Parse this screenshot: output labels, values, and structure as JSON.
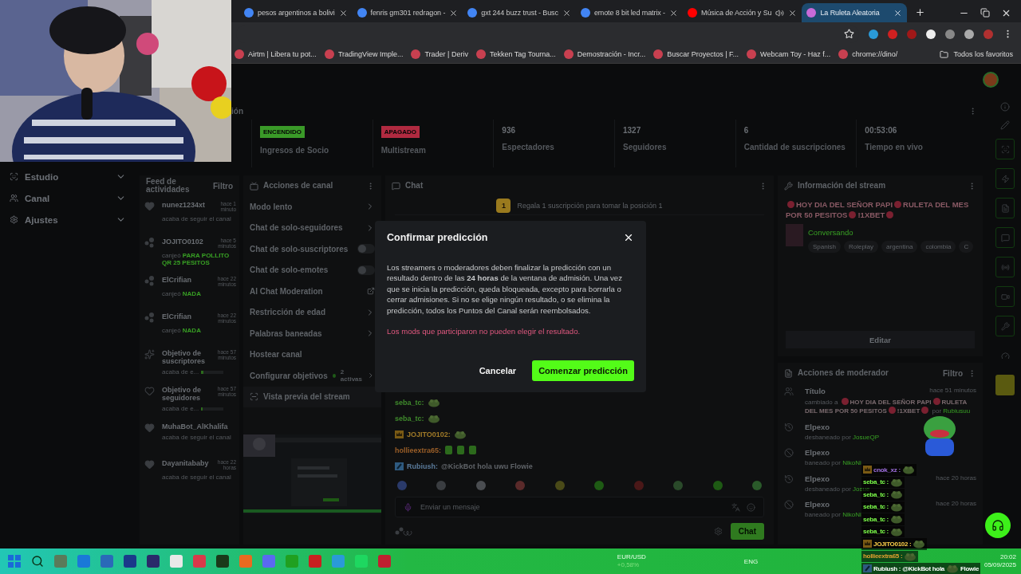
{
  "browser": {
    "tabs": [
      {
        "title": "pesos argentinos a bolivi",
        "kind": "google",
        "audio": false,
        "selected": false
      },
      {
        "title": "fenris gm301 redragon -",
        "kind": "google",
        "audio": false,
        "selected": false
      },
      {
        "title": "gxt 244 buzz trust - Busc",
        "kind": "google",
        "audio": false,
        "selected": false
      },
      {
        "title": "emote 8 bit led matrix -",
        "kind": "google",
        "audio": false,
        "selected": false
      },
      {
        "title": "Música de Acción y Su",
        "kind": "youtube",
        "audio": true,
        "selected": false
      },
      {
        "title": "La Ruleta Aleatoria",
        "kind": "roulette",
        "audio": false,
        "selected": true
      }
    ],
    "bookmarks": [
      "Airtm | Libera tu pot...",
      "TradingView Imple...",
      "Trader | Deriv",
      "Tekken Tag Tourna...",
      "Demostración - Incr...",
      "Buscar Proyectos | F...",
      "Webcam Toy - Haz f...",
      "chrome://dino/"
    ],
    "all_bookmarks": "Todos los favoritos"
  },
  "nav": [
    {
      "label": "Estudio",
      "kind": "studio"
    },
    {
      "label": "Canal",
      "kind": "channel"
    },
    {
      "label": "Ajustes",
      "kind": "settings"
    }
  ],
  "stats_title": "ión",
  "stats": [
    {
      "kind": "badge",
      "badge": "ENCENDIDO",
      "color": "#3a9a28",
      "label": "Ingresos de Socio"
    },
    {
      "kind": "badge",
      "badge": "APAGADO",
      "color": "#b02a40",
      "label": "Multistream"
    },
    {
      "kind": "value",
      "value": "936",
      "label": "Espectadores"
    },
    {
      "kind": "value",
      "value": "1327",
      "label": "Seguidores"
    },
    {
      "kind": "value",
      "value": "6",
      "label": "Cantidad de suscripciones"
    },
    {
      "kind": "value",
      "value": "00:53:06",
      "label": "Tiempo en vivo"
    }
  ],
  "feed": {
    "title": "Feed de actividades",
    "filter": "Filtro",
    "items": [
      {
        "kind": "follow",
        "user": "nunez1234xt",
        "time": "hace 1 minuto",
        "text": "acaba de seguir el canal"
      },
      {
        "kind": "redeem",
        "user": "JOJITO0102",
        "time": "hace 5 minutos",
        "text": "canjeó",
        "reward": "PARA POLLITO QR 25 PESITOS"
      },
      {
        "kind": "redeem",
        "user": "ElCrifian",
        "time": "hace 22 minutos",
        "text": "canjeó",
        "reward": "NADA"
      },
      {
        "kind": "redeem",
        "user": "ElCrifian",
        "time": "hace 22 minutos",
        "text": "canjeó",
        "reward": "NADA"
      },
      {
        "kind": "goal",
        "user": "Objetivo de suscriptores",
        "time": "hace 57 minutos",
        "text": "acaba de e...",
        "level": 0.1
      },
      {
        "kind": "goal_follow",
        "user": "Objetivo de seguidores",
        "time": "hace 57 minutos",
        "text": "acaba de e...",
        "level": 0.05
      },
      {
        "kind": "follow",
        "user": "MuhaBot_AlKhalifa",
        "text": "acaba de seguir el canal"
      },
      {
        "kind": "follow",
        "user": "Dayanitababy",
        "time": "hace 22 horas",
        "text": "acaba de seguir el canal"
      }
    ]
  },
  "channel_actions": {
    "title": "Acciones de canal",
    "items": [
      {
        "kind": "link",
        "label": "Modo lento"
      },
      {
        "kind": "link",
        "label": "Chat de solo-seguidores"
      },
      {
        "kind": "toggle",
        "label": "Chat de solo-suscriptores",
        "on": false
      },
      {
        "kind": "toggle",
        "label": "Chat de solo-emotes",
        "on": false
      },
      {
        "kind": "external",
        "label": "AI Chat Moderation"
      },
      {
        "kind": "link",
        "label": "Restricción de edad"
      },
      {
        "kind": "link",
        "label": "Palabras baneadas"
      },
      {
        "kind": "plain",
        "label": "Hostear canal"
      },
      {
        "kind": "link",
        "label": "Configurar objetivos",
        "badge": "2 activas"
      }
    ]
  },
  "preview": {
    "title": "Vista previa del stream"
  },
  "chat": {
    "title": "Chat",
    "pinned_rank": "1",
    "pinned": "Regala 1 suscripción para tomar la posición 1",
    "messages": [
      {
        "user": "seba_tc:",
        "color": "#3f8a2c",
        "kind": "plain",
        "emotes": [
          {
            "kind": "frog"
          }
        ]
      },
      {
        "user": "seba_tc:",
        "color": "#3f8a2c",
        "kind": "plain",
        "emotes": [
          {
            "kind": "frog"
          }
        ]
      },
      {
        "user": "JOJITO0102:",
        "color": "#a07a28",
        "kind": "crown",
        "emotes": [
          {
            "kind": "frog"
          }
        ]
      },
      {
        "user": "hollieextra65:",
        "color": "#9a5e28",
        "kind": "plain",
        "emotes": [
          {
            "kind": "cup"
          },
          {
            "kind": "cup"
          },
          {
            "kind": "cup"
          }
        ]
      },
      {
        "user": "Rubiush:",
        "color": "#5a7a9a",
        "kind": "star",
        "text": "@KickBot hola uwu Flowie"
      }
    ],
    "placeholder": "Enviar un mensaje",
    "send": "Chat"
  },
  "stream_info": {
    "title": "Información del stream",
    "stream_title": [
      "HOY DIA DEL SEÑOR PAPI",
      "RULETA DEL MES POR 50 PESITOS",
      "!1XBET"
    ],
    "category": "Conversando",
    "tags": [
      "Spanish",
      "Roleplay",
      "argentina",
      "colombia",
      "C"
    ],
    "edit": "Editar"
  },
  "mod_actions": {
    "title": "Acciones de moderador",
    "filter": "Filtro",
    "items": [
      {
        "kind": "title",
        "user": "Título",
        "time": "hace 51 minutos",
        "detail": "cambiado a",
        "new_title": [
          "HOY DIA DEL SEÑOR PAPI",
          "RULETA DEL MES POR 50 PESITOS",
          "!1XBET"
        ],
        "by_label": "por",
        "by": "Rubiusuu"
      },
      {
        "kind": "unban",
        "user": "Elpexo",
        "detail": "desbaneado por",
        "by": "JosueQP"
      },
      {
        "kind": "ban",
        "user": "Elpexo",
        "detail": "baneado por",
        "by": "NikoNi"
      },
      {
        "kind": "unban",
        "user": "Elpexo",
        "time": "hace 20 horas",
        "detail": "desbaneado por",
        "by": "Josue"
      },
      {
        "kind": "ban",
        "user": "Elpexo",
        "time": "hace 20 horas",
        "detail": "baneado por",
        "by": "NikoNi"
      }
    ]
  },
  "modal": {
    "title": "Confirmar predicción",
    "body": "Los streamers o moderadores deben finalizar la predicción con un resultado dentro de las **24 horas** de la ventana de admisión. Una vez que se inicia la predicción, queda bloqueada, excepto para borrarla o cerrar admisiones. Si no se elige ningún resultado, o se elimina la predicción, todos los Puntos del Canal serán reembolsados.",
    "warning": "Los mods que participaron no pueden elegir el resultado.",
    "cancel": "Cancelar",
    "confirm": "Comenzar predicción"
  },
  "overlay_chat": [
    {
      "user": "cnok_xz :",
      "color": "#a070e0",
      "kind": "crown"
    },
    {
      "user": "seba_tc :",
      "color": "#7dff4a",
      "kind": "plain"
    },
    {
      "user": "seba_tc :",
      "color": "#7dff4a",
      "kind": "plain"
    },
    {
      "user": "seba_tc :",
      "color": "#7dff4a",
      "kind": "plain"
    },
    {
      "user": "seba_tc :",
      "color": "#7dff4a",
      "kind": "plain"
    },
    {
      "user": "seba_tc :",
      "color": "#7dff4a",
      "kind": "plain"
    },
    {
      "user": "JOJITO0102 :",
      "color": "#ffd24a",
      "kind": "crown"
    },
    {
      "user": "hollieextra65 :",
      "color": "#e0a030",
      "kind": "plain"
    },
    {
      "user": "Rubiush :",
      "color": "#ffffff",
      "kind": "star",
      "text": "@KickBot hola",
      "after": "Flowie"
    }
  ],
  "taskbar": {
    "ticker": "EUR/USD",
    "change": "+0,58%",
    "language": "ENG",
    "time": "20:02",
    "date": "05/09/2025"
  }
}
